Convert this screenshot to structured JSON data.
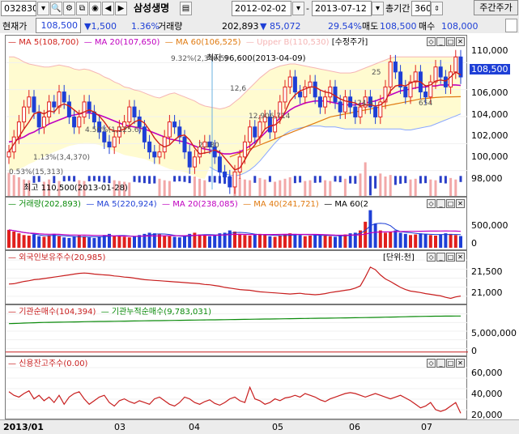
{
  "toolbar": {
    "code": "032830",
    "name": "삼성생명",
    "start_date": "2012-02-02",
    "end_date": "2013-07-12",
    "period_label": "총기간",
    "period_value": "360",
    "weekly_button": "주간주가"
  },
  "quote": {
    "current_label": "현재가",
    "price": "108,500",
    "change": "▼1,500",
    "change_pct": "1.36%",
    "volume_label": "거래량",
    "volume": "202,893",
    "volume_change": "▼ 85,072",
    "ratio": "29.54%",
    "sell_label": "매도",
    "ask": "108,500",
    "bid_label": "매수",
    "bid": "108,000"
  },
  "colors": {
    "up": "#e0201d",
    "down": "#1e3fd6",
    "ma5": "#d0201a",
    "ma20": "#c000c0",
    "ma60": "#e07a10",
    "env_fill": "#fffbd0",
    "env_line": "#f5b5b5",
    "boll": "#8aa8ff",
    "foreign": "#c81e1e",
    "inst_cum": "#0a8a0a"
  },
  "price_panel": {
    "legend": [
      "MA 5(108,700)",
      "MA 20(107,650)",
      "MA 60(106,525)",
      "Upper B(110,530)",
      "[수정주가]"
    ],
    "annotations": [
      "최고 110,500(2013-01-28)",
      "최저 96,600(2013-04-09)",
      "9.32%(2,346.5)",
      "4.50%(1,125.6)",
      "1.13%(3,4,370)",
      "0.53%(15,313)",
      "12,6",
      "12,906,714",
      "2,180",
      "25",
      "24,4",
      "654"
    ],
    "current_marker": "108,500",
    "y_ticks": [
      "110,000",
      "108,000",
      "106,000",
      "104,000",
      "102,000",
      "100,000",
      "98,000"
    ]
  },
  "volume_panel": {
    "legend": [
      "거래량(202,893)",
      "MA 5(220,924)",
      "MA 20(238,085)",
      "MA 40(241,721)",
      "MA 60(2"
    ],
    "y_ticks": [
      "500,000",
      "0"
    ]
  },
  "foreign_panel": {
    "legend": "외국인보유주수(20,985)",
    "unit": "[단위:천]",
    "y_ticks": [
      "21,500",
      "21,000"
    ]
  },
  "inst_panel": {
    "legend": [
      "기관순매수(104,394)",
      "기관누적순매수(9,783,031)"
    ],
    "y_ticks": [
      "5,000,000",
      "0"
    ]
  },
  "credit_panel": {
    "legend": "신용잔고주수(0.00)",
    "y_ticks": [
      "60,000",
      "40,000",
      "20,000"
    ]
  },
  "x_axis": [
    "2013/01",
    "03",
    "04",
    "05",
    "06",
    "07"
  ],
  "chart_data": {
    "type": "candlestick",
    "x_range": [
      "2013-01",
      "2013-07-12"
    ],
    "price": {
      "ylim": [
        96600,
        111500
      ],
      "close": [
        101000,
        102500,
        104000,
        105500,
        106500,
        105000,
        103500,
        104500,
        106000,
        105500,
        107000,
        106000,
        104500,
        103500,
        104500,
        106000,
        105000,
        104000,
        103000,
        102000,
        101500,
        102500,
        103500,
        104000,
        105500,
        104500,
        103500,
        102000,
        101000,
        100500,
        101000,
        102500,
        104000,
        103500,
        102500,
        101000,
        99500,
        100500,
        101500,
        102000,
        101500,
        100500,
        99000,
        98500,
        97500,
        99000,
        100500,
        102000,
        103500,
        102500,
        104000,
        104500,
        103000,
        104500,
        106000,
        107500,
        108500,
        107000,
        106500,
        107500,
        108000,
        106500,
        105500,
        106500,
        107500,
        106000,
        105000,
        106500,
        105500,
        104500,
        105500,
        106500,
        105500,
        104500,
        106000,
        107500,
        110000,
        109000,
        107500,
        106500,
        108000,
        109000,
        107000,
        106500,
        108000,
        109500,
        108500,
        107500,
        109000,
        110500,
        108500
      ],
      "ma5": [
        101000,
        101800,
        102500,
        103300,
        104000,
        104800,
        105000,
        104800,
        105100,
        105000,
        105600,
        105800,
        105600,
        105200,
        104800,
        105000,
        105200,
        105000,
        104600,
        104000,
        103300,
        103100,
        103100,
        103300,
        103600,
        104000,
        104200,
        103900,
        103200,
        102400,
        101800,
        101500,
        101700,
        102200,
        102600,
        102700,
        102200,
        101400,
        100800,
        100900,
        101000,
        101200,
        101000,
        100400,
        99800,
        99200,
        99400,
        100200,
        101100,
        101700,
        102500,
        103300,
        103600,
        103700,
        104100,
        105000,
        106100,
        106700,
        107100,
        107300,
        107500,
        107500,
        107200,
        107000,
        106900,
        106600,
        106300,
        106100,
        106000,
        105900,
        105600,
        105700,
        105700,
        105600,
        105700,
        106100,
        107100,
        107600,
        107700,
        107600,
        107900,
        108100,
        108000,
        107600,
        107700,
        108100,
        108200,
        108100,
        108500,
        109000,
        108700
      ],
      "ma20": [
        102000,
        102100,
        102300,
        102500,
        102800,
        103000,
        103300,
        103500,
        103800,
        104000,
        104200,
        104400,
        104600,
        104700,
        104800,
        104900,
        104900,
        104800,
        104700,
        104500,
        104300,
        104100,
        103900,
        103700,
        103600,
        103500,
        103400,
        103300,
        103100,
        102900,
        102700,
        102500,
        102300,
        102200,
        102100,
        102000,
        101800,
        101600,
        101400,
        101300,
        101200,
        101100,
        100900,
        100800,
        100800,
        100900,
        101000,
        101300,
        101600,
        102000,
        102400,
        102900,
        103400,
        103900,
        104400,
        104800,
        105200,
        105500,
        105700,
        105900,
        106000,
        106100,
        106100,
        106100,
        106000,
        105900,
        105800,
        105700,
        105700,
        105700,
        105800,
        105900,
        106000,
        106100,
        106300,
        106500,
        106700,
        106900,
        107100,
        107200,
        107300,
        107400,
        107500,
        107500,
        107600,
        107600,
        107700,
        107700,
        107700,
        107700,
        107650
      ],
      "ma60": [
        null,
        null,
        null,
        null,
        null,
        null,
        null,
        null,
        null,
        null,
        null,
        null,
        null,
        null,
        null,
        null,
        null,
        null,
        null,
        null,
        null,
        null,
        null,
        null,
        null,
        null,
        null,
        null,
        null,
        null,
        null,
        null,
        null,
        null,
        null,
        null,
        null,
        null,
        null,
        null,
        null,
        null,
        null,
        null,
        100500,
        100700,
        100900,
        101100,
        101300,
        101500,
        101700,
        101900,
        102100,
        102300,
        102500,
        102700,
        102900,
        103100,
        103300,
        103500,
        103700,
        103900,
        104100,
        104300,
        104500,
        104600,
        104700,
        104800,
        104900,
        105000,
        105100,
        105200,
        105300,
        105400,
        105500,
        105600,
        105700,
        105800,
        105900,
        106000,
        106100,
        106200,
        106300,
        106350,
        106400,
        106450,
        106480,
        106500,
        106510,
        106520,
        106525
      ],
      "upper_band": [
        110500,
        110500,
        110300,
        110000,
        109800,
        109700,
        109600,
        109500,
        109500,
        109600,
        109700,
        109600,
        109500,
        109300,
        109200,
        109300,
        109200,
        109000,
        108800,
        108500,
        108300,
        108000,
        107800,
        107500,
        107400,
        107200,
        107100,
        106900,
        106700,
        106500,
        106400,
        106600,
        106800,
        106900,
        106700,
        106500,
        106300,
        106100,
        105800,
        105600,
        105500,
        105400,
        105300,
        105400,
        105600,
        106000,
        106400,
        106900,
        107400,
        107900,
        108400,
        108800,
        109200,
        109400,
        109600,
        109700,
        109800,
        109800,
        109700,
        109600,
        109500,
        109400,
        109300,
        109200,
        109100,
        109000,
        108900,
        108900,
        108900,
        109000,
        109200,
        109400,
        109600,
        109800,
        110000,
        110200,
        110400,
        110500,
        110500,
        110500,
        110500,
        110500,
        110500,
        110500,
        110500,
        110500,
        110500,
        110500,
        110500,
        110530,
        110530
      ],
      "lower_band": [
        null,
        null,
        null,
        null,
        null,
        null,
        null,
        null,
        null,
        null,
        null,
        null,
        null,
        null,
        null,
        null,
        null,
        null,
        null,
        null,
        null,
        null,
        null,
        null,
        null,
        null,
        null,
        null,
        null,
        null,
        null,
        null,
        null,
        null,
        null,
        null,
        null,
        null,
        null,
        null,
        99500,
        99200,
        99000,
        98800,
        98700,
        98600,
        98700,
        98900,
        99200,
        99600,
        100100,
        100700,
        101300,
        101900,
        102400,
        102800,
        103100,
        103300,
        103400,
        103500,
        103600,
        103600,
        103600,
        103500,
        103500,
        103500,
        103400,
        103300,
        103300,
        103300,
        103300,
        103300,
        103300,
        103300,
        103300,
        103300,
        103300,
        103300,
        103300,
        103200,
        103200,
        103300,
        103400,
        103500,
        103600,
        103800,
        104000,
        104200,
        104400,
        104600,
        104800
      ]
    },
    "volume": {
      "ylim": [
        0,
        700000
      ],
      "values": [
        310000,
        280000,
        250000,
        220000,
        210000,
        230000,
        200000,
        190000,
        220000,
        240000,
        200000,
        180000,
        170000,
        190000,
        210000,
        200000,
        180000,
        170000,
        190000,
        220000,
        240000,
        210000,
        200000,
        190000,
        180000,
        200000,
        220000,
        240000,
        260000,
        250000,
        230000,
        210000,
        200000,
        190000,
        180000,
        200000,
        240000,
        260000,
        230000,
        210000,
        200000,
        220000,
        250000,
        260000,
        300000,
        280000,
        240000,
        220000,
        210000,
        230000,
        240000,
        220000,
        200000,
        190000,
        210000,
        230000,
        250000,
        240000,
        220000,
        200000,
        210000,
        230000,
        220000,
        210000,
        200000,
        190000,
        210000,
        230000,
        250000,
        260000,
        300000,
        450000,
        650000,
        420000,
        300000,
        260000,
        280000,
        300000,
        260000,
        240000,
        220000,
        230000,
        250000,
        240000,
        220000,
        210000,
        230000,
        250000,
        240000,
        220000,
        202893
      ]
    },
    "foreign_holdings": {
      "ylim": [
        20800,
        21900
      ],
      "values": [
        21310,
        21320,
        21350,
        21380,
        21400,
        21430,
        21440,
        21460,
        21480,
        21500,
        21520,
        21540,
        21560,
        21580,
        21600,
        21610,
        21600,
        21580,
        21570,
        21560,
        21550,
        21530,
        21520,
        21500,
        21490,
        21470,
        21450,
        21430,
        21420,
        21410,
        21400,
        21390,
        21380,
        21370,
        21360,
        21350,
        21340,
        21330,
        21320,
        21300,
        21290,
        21270,
        21250,
        21220,
        21200,
        21180,
        21160,
        21150,
        21140,
        21120,
        21100,
        21090,
        21080,
        21070,
        21060,
        21050,
        21040,
        21050,
        21060,
        21040,
        21030,
        21020,
        21030,
        21050,
        21080,
        21100,
        21120,
        21140,
        21160,
        21200,
        21260,
        21500,
        21770,
        21700,
        21560,
        21450,
        21380,
        21300,
        21220,
        21160,
        21120,
        21100,
        21080,
        21050,
        21030,
        21010,
        20990,
        20950,
        20920,
        20960,
        20985
      ]
    },
    "institution": {
      "ylim": [
        -500000,
        10500000
      ],
      "cumulative": [
        7700000,
        7750000,
        7800000,
        7850000,
        7900000,
        7950000,
        8000000,
        8030000,
        8060000,
        8090000,
        8110000,
        8130000,
        8150000,
        8170000,
        8200000,
        8230000,
        8250000,
        8270000,
        8290000,
        8310000,
        8330000,
        8350000,
        8370000,
        8390000,
        8410000,
        8430000,
        8450000,
        8470000,
        8490000,
        8510000,
        8530000,
        8550000,
        8570000,
        8590000,
        8610000,
        8630000,
        8650000,
        8670000,
        8690000,
        8710000,
        8730000,
        8750000,
        8770000,
        8790000,
        8810000,
        8830000,
        8850000,
        8870000,
        8890000,
        8910000,
        8930000,
        8950000,
        8970000,
        8990000,
        9010000,
        9030000,
        9050000,
        9070000,
        9090000,
        9110000,
        9130000,
        9150000,
        9170000,
        9190000,
        9210000,
        9230000,
        9250000,
        9270000,
        9290000,
        9310000,
        9330000,
        9350000,
        9370000,
        9400000,
        9430000,
        9460000,
        9490000,
        9520000,
        9550000,
        9580000,
        9610000,
        9640000,
        9660000,
        9680000,
        9700000,
        9720000,
        9740000,
        9750000,
        9760000,
        9770000,
        9783031
      ]
    },
    "credit_balance": {
      "ylim": [
        14000,
        70000
      ],
      "values": [
        44000,
        40000,
        38000,
        42000,
        45000,
        36000,
        40000,
        34000,
        38000,
        32000,
        40000,
        30000,
        38000,
        42000,
        44000,
        36000,
        30000,
        34000,
        38000,
        40000,
        32000,
        28000,
        34000,
        36000,
        33000,
        31000,
        34000,
        32000,
        30000,
        36000,
        38000,
        34000,
        30000,
        28000,
        32000,
        38000,
        36000,
        32000,
        30000,
        33000,
        35000,
        31000,
        29000,
        32000,
        36000,
        38000,
        34000,
        32000,
        49000,
        36000,
        34000,
        30000,
        32000,
        36000,
        34000,
        37000,
        38000,
        40000,
        38000,
        42000,
        40000,
        38000,
        35000,
        33000,
        36000,
        38000,
        40000,
        42000,
        43000,
        42000,
        40000,
        38000,
        40000,
        42000,
        40000,
        38000,
        36000,
        38000,
        40000,
        37000,
        34000,
        30000,
        26000,
        28000,
        32000,
        24000,
        22000,
        24000,
        28000,
        32000,
        20000
      ]
    }
  }
}
